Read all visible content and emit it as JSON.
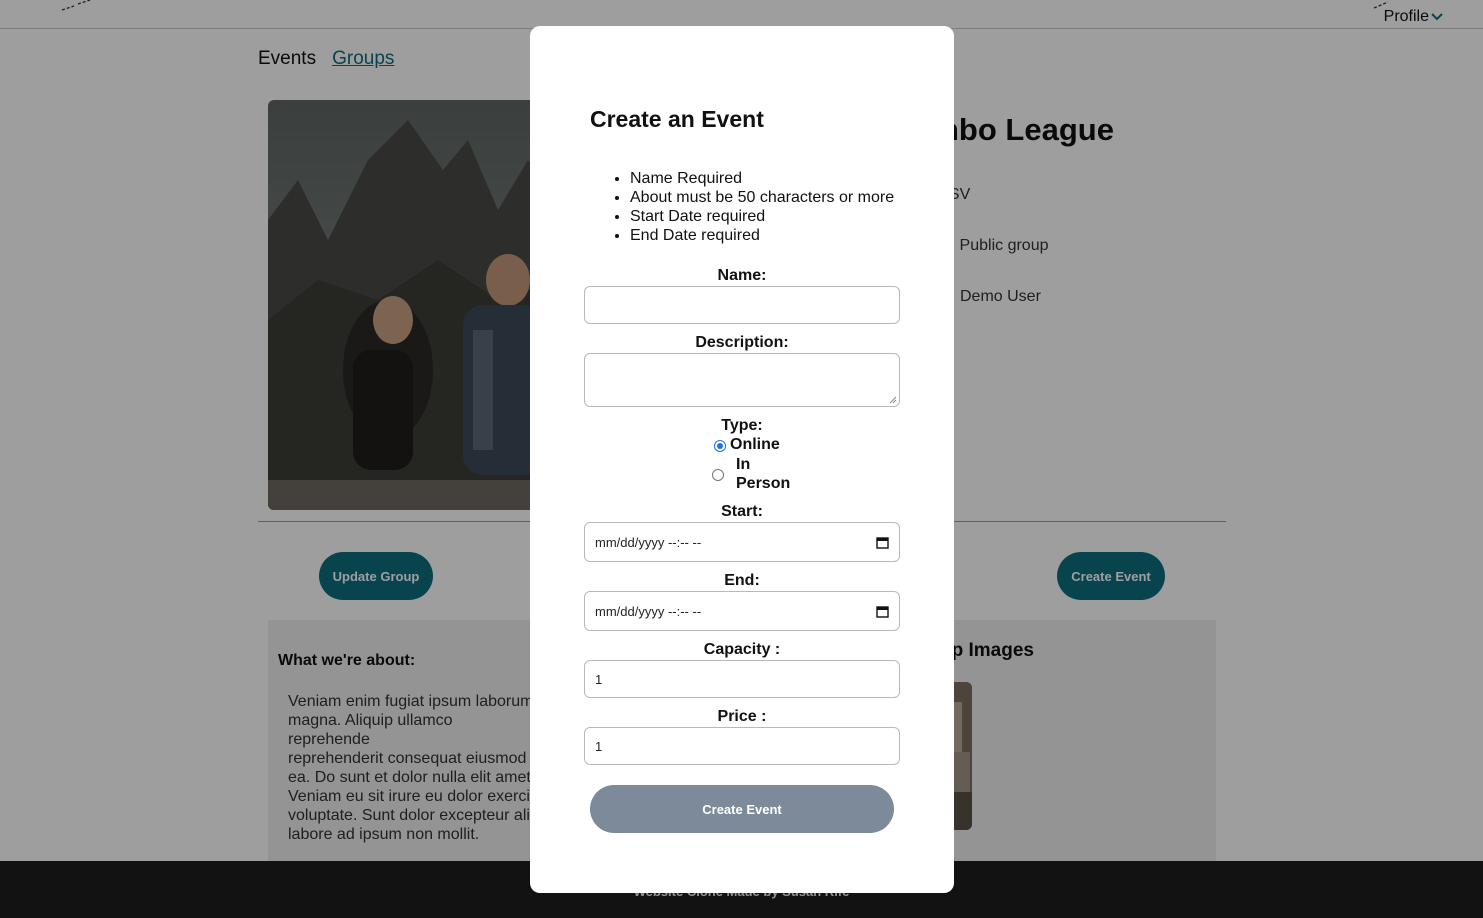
{
  "header": {
    "profile_label": "Profile"
  },
  "nav": {
    "events": "Events",
    "groups": "Groups"
  },
  "group": {
    "title": "nbo League",
    "location": ", SV",
    "visibility": "r · Public group",
    "organizer": "Demo User",
    "update_button": "Update Group",
    "create_event_button": "Create Event"
  },
  "about": {
    "heading": "What we're about:",
    "text": "Veniam enim fugiat ipsum laborum\nmagna. Aliquip ullamco reprehende\nreprehenderit consequat eiusmod i\nea. Do sunt et dolor nulla elit amet\nVeniam eu sit irure eu dolor exerciti\nvoluptate. Sunt dolor excepteur alic\nlabore ad ipsum non mollit."
  },
  "group_images": {
    "heading": "up Images"
  },
  "footer": {
    "text": "Website Clone Made by Susan Rife"
  },
  "modal": {
    "title": "Create an Event",
    "errors": [
      "Name Required",
      "About must be 50 characters or more",
      "Start Date required",
      "End Date required"
    ],
    "name_label": "Name:",
    "name_value": "",
    "description_label": "Description:",
    "description_value": "",
    "type_label": "Type:",
    "type_options": [
      {
        "label": "Online",
        "selected": true
      },
      {
        "label": "In Person",
        "selected": false
      }
    ],
    "start_label": "Start:",
    "start_placeholder": "mm/dd/yyyy --:-- --",
    "end_label": "End:",
    "end_placeholder": "mm/dd/yyyy --:-- --",
    "capacity_label": "Capacity :",
    "capacity_value": "1",
    "price_label": "Price :",
    "price_value": "1",
    "submit_label": "Create Event"
  },
  "colors": {
    "accent": "#0d6e7e",
    "submit_disabled": "#7c8a99",
    "footer": "#1d1d1d",
    "radio_selected": "#1a73e8"
  },
  "icons": [
    "chevron-down-icon",
    "calendar-icon",
    "resize-grip-icon"
  ]
}
